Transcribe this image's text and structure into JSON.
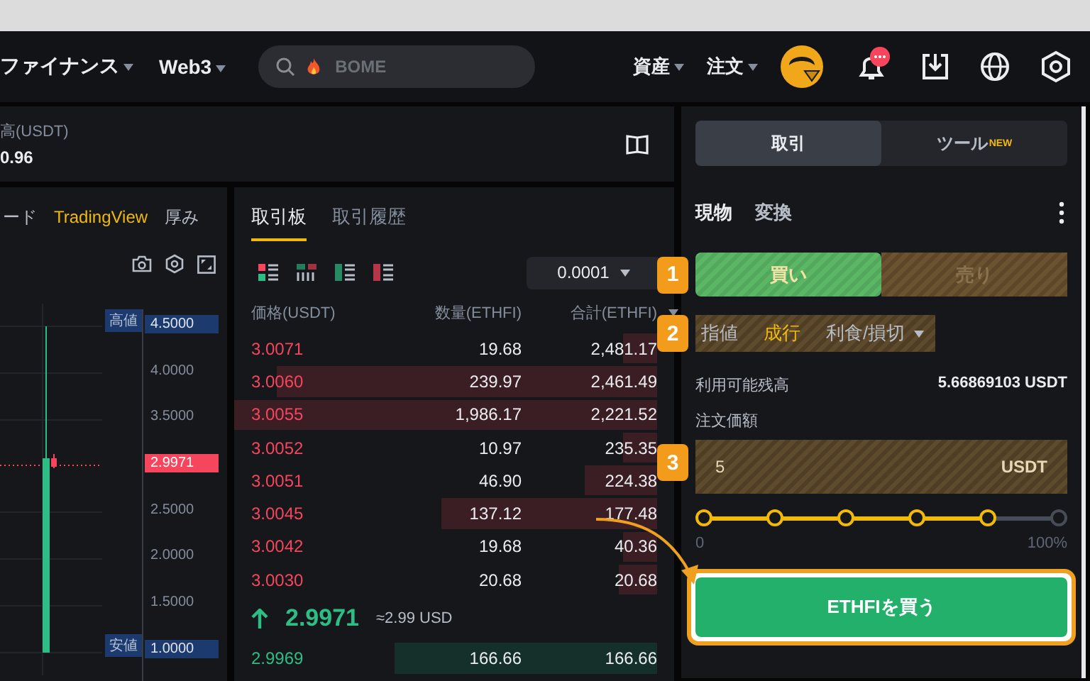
{
  "nav": {
    "menus": [
      {
        "label": "ファイナンス"
      },
      {
        "label": "Web3"
      }
    ],
    "search": {
      "placeholder": "BOME"
    },
    "right_menus": [
      {
        "label": "資産"
      },
      {
        "label": "注文"
      }
    ]
  },
  "balance": {
    "label": "高(USDT)",
    "value": "0.96"
  },
  "chart": {
    "tabs": [
      {
        "label": "ード",
        "selected": false
      },
      {
        "label": "TradingView",
        "selected": true
      },
      {
        "label": "厚み",
        "selected": false
      }
    ],
    "axis": [
      {
        "kind": "high",
        "tag": "高値",
        "value": "4.5000"
      },
      {
        "kind": "tick",
        "value": "4.0000"
      },
      {
        "kind": "tick",
        "value": "3.5000"
      },
      {
        "kind": "current",
        "value": "2.9971"
      },
      {
        "kind": "tick",
        "value": "2.5000"
      },
      {
        "kind": "tick",
        "value": "2.0000"
      },
      {
        "kind": "tick",
        "value": "1.5000"
      },
      {
        "kind": "low",
        "tag": "安値",
        "value": "1.0000"
      }
    ]
  },
  "orderbook": {
    "tabs": [
      {
        "label": "取引板",
        "selected": true
      },
      {
        "label": "取引履歴",
        "selected": false
      }
    ],
    "precision": "0.0001",
    "columns": [
      "価格(USDT)",
      "数量(ETHFI)",
      "合計(ETHFI)"
    ],
    "asks": [
      {
        "price": "3.0071",
        "amount": "19.68",
        "total": "2,481.17",
        "level": 0.08
      },
      {
        "price": "3.0060",
        "amount": "239.97",
        "total": "2,461.49",
        "level": 0.9
      },
      {
        "price": "3.0055",
        "amount": "1,986.17",
        "total": "2,221.52",
        "level": 1
      },
      {
        "price": "3.0052",
        "amount": "10.97",
        "total": "235.35",
        "level": 0.08
      },
      {
        "price": "3.0051",
        "amount": "46.90",
        "total": "224.38",
        "level": 0.17
      },
      {
        "price": "3.0045",
        "amount": "137.12",
        "total": "177.48",
        "level": 0.51
      },
      {
        "price": "3.0042",
        "amount": "19.68",
        "total": "40.36",
        "level": 0.08
      },
      {
        "price": "3.0030",
        "amount": "20.68",
        "total": "20.68",
        "level": 0.09
      }
    ],
    "last_price": "2.9971",
    "last_price_usd": "≈2.99 USD",
    "bids": [
      {
        "price": "2.9969",
        "amount": "166.66",
        "total": "166.66",
        "level": 0.62
      }
    ]
  },
  "trade": {
    "tabs": [
      {
        "label": "取引",
        "selected": true
      },
      {
        "label": "ツール",
        "selected": false,
        "badge": "NEW"
      }
    ],
    "modes": [
      {
        "label": "現物",
        "selected": true
      },
      {
        "label": "変換",
        "selected": false
      }
    ],
    "sides": [
      {
        "label": "買い",
        "selected": true
      },
      {
        "label": "売り",
        "selected": false
      }
    ],
    "order_types": [
      {
        "label": "指値",
        "selected": false,
        "dropdown": false
      },
      {
        "label": "成行",
        "selected": true,
        "dropdown": false
      },
      {
        "label": "利食/損切",
        "selected": false,
        "dropdown": true
      }
    ],
    "available_label": "利用可能残高",
    "available_value": "5.66869103 USDT",
    "amount_label": "注文価額",
    "amount_value": "5",
    "amount_unit": "USDT",
    "slider": {
      "level": 0.8,
      "min_label": "0",
      "max_label": "100%"
    },
    "submit": "ETHFIを買う"
  },
  "callouts": [
    "1",
    "2",
    "3"
  ]
}
